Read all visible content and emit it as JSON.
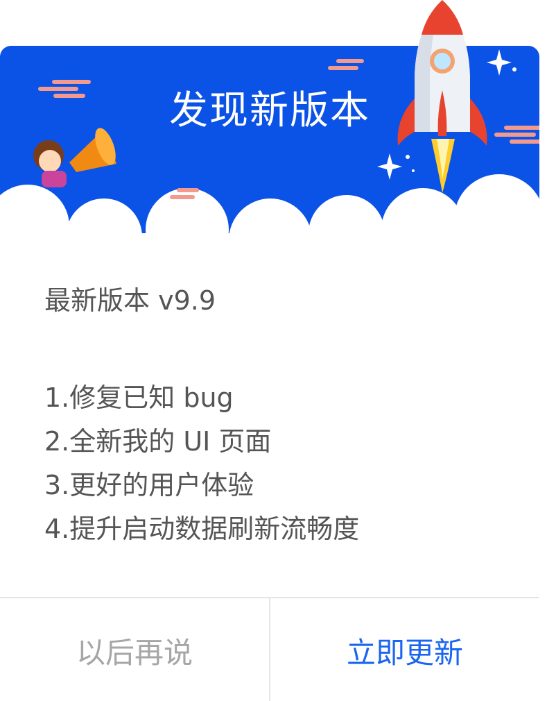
{
  "colors": {
    "banner_blue": "#0b52e6",
    "cloud": "#ffffff",
    "accent_pink": "#f39a8e",
    "rocket_red": "#e8432f",
    "rocket_flame": "#ffce2b",
    "primary_button": "#1b66f0",
    "secondary_button": "#a6a6a6",
    "body_text": "#555555"
  },
  "banner": {
    "title": "发现新版本",
    "icons": [
      "rocket-icon",
      "megaphone-girl-icon",
      "sparkle-icon",
      "cloud-streak-icon"
    ]
  },
  "content": {
    "version_label": "最新版本 v9.9",
    "changes": [
      "1.修复已知 bug",
      "2.全新我的 UI 页面",
      "3.更好的用户体验",
      "4.提升启动数据刷新流畅度"
    ]
  },
  "footer": {
    "later_label": "以后再说",
    "update_label": "立即更新"
  }
}
